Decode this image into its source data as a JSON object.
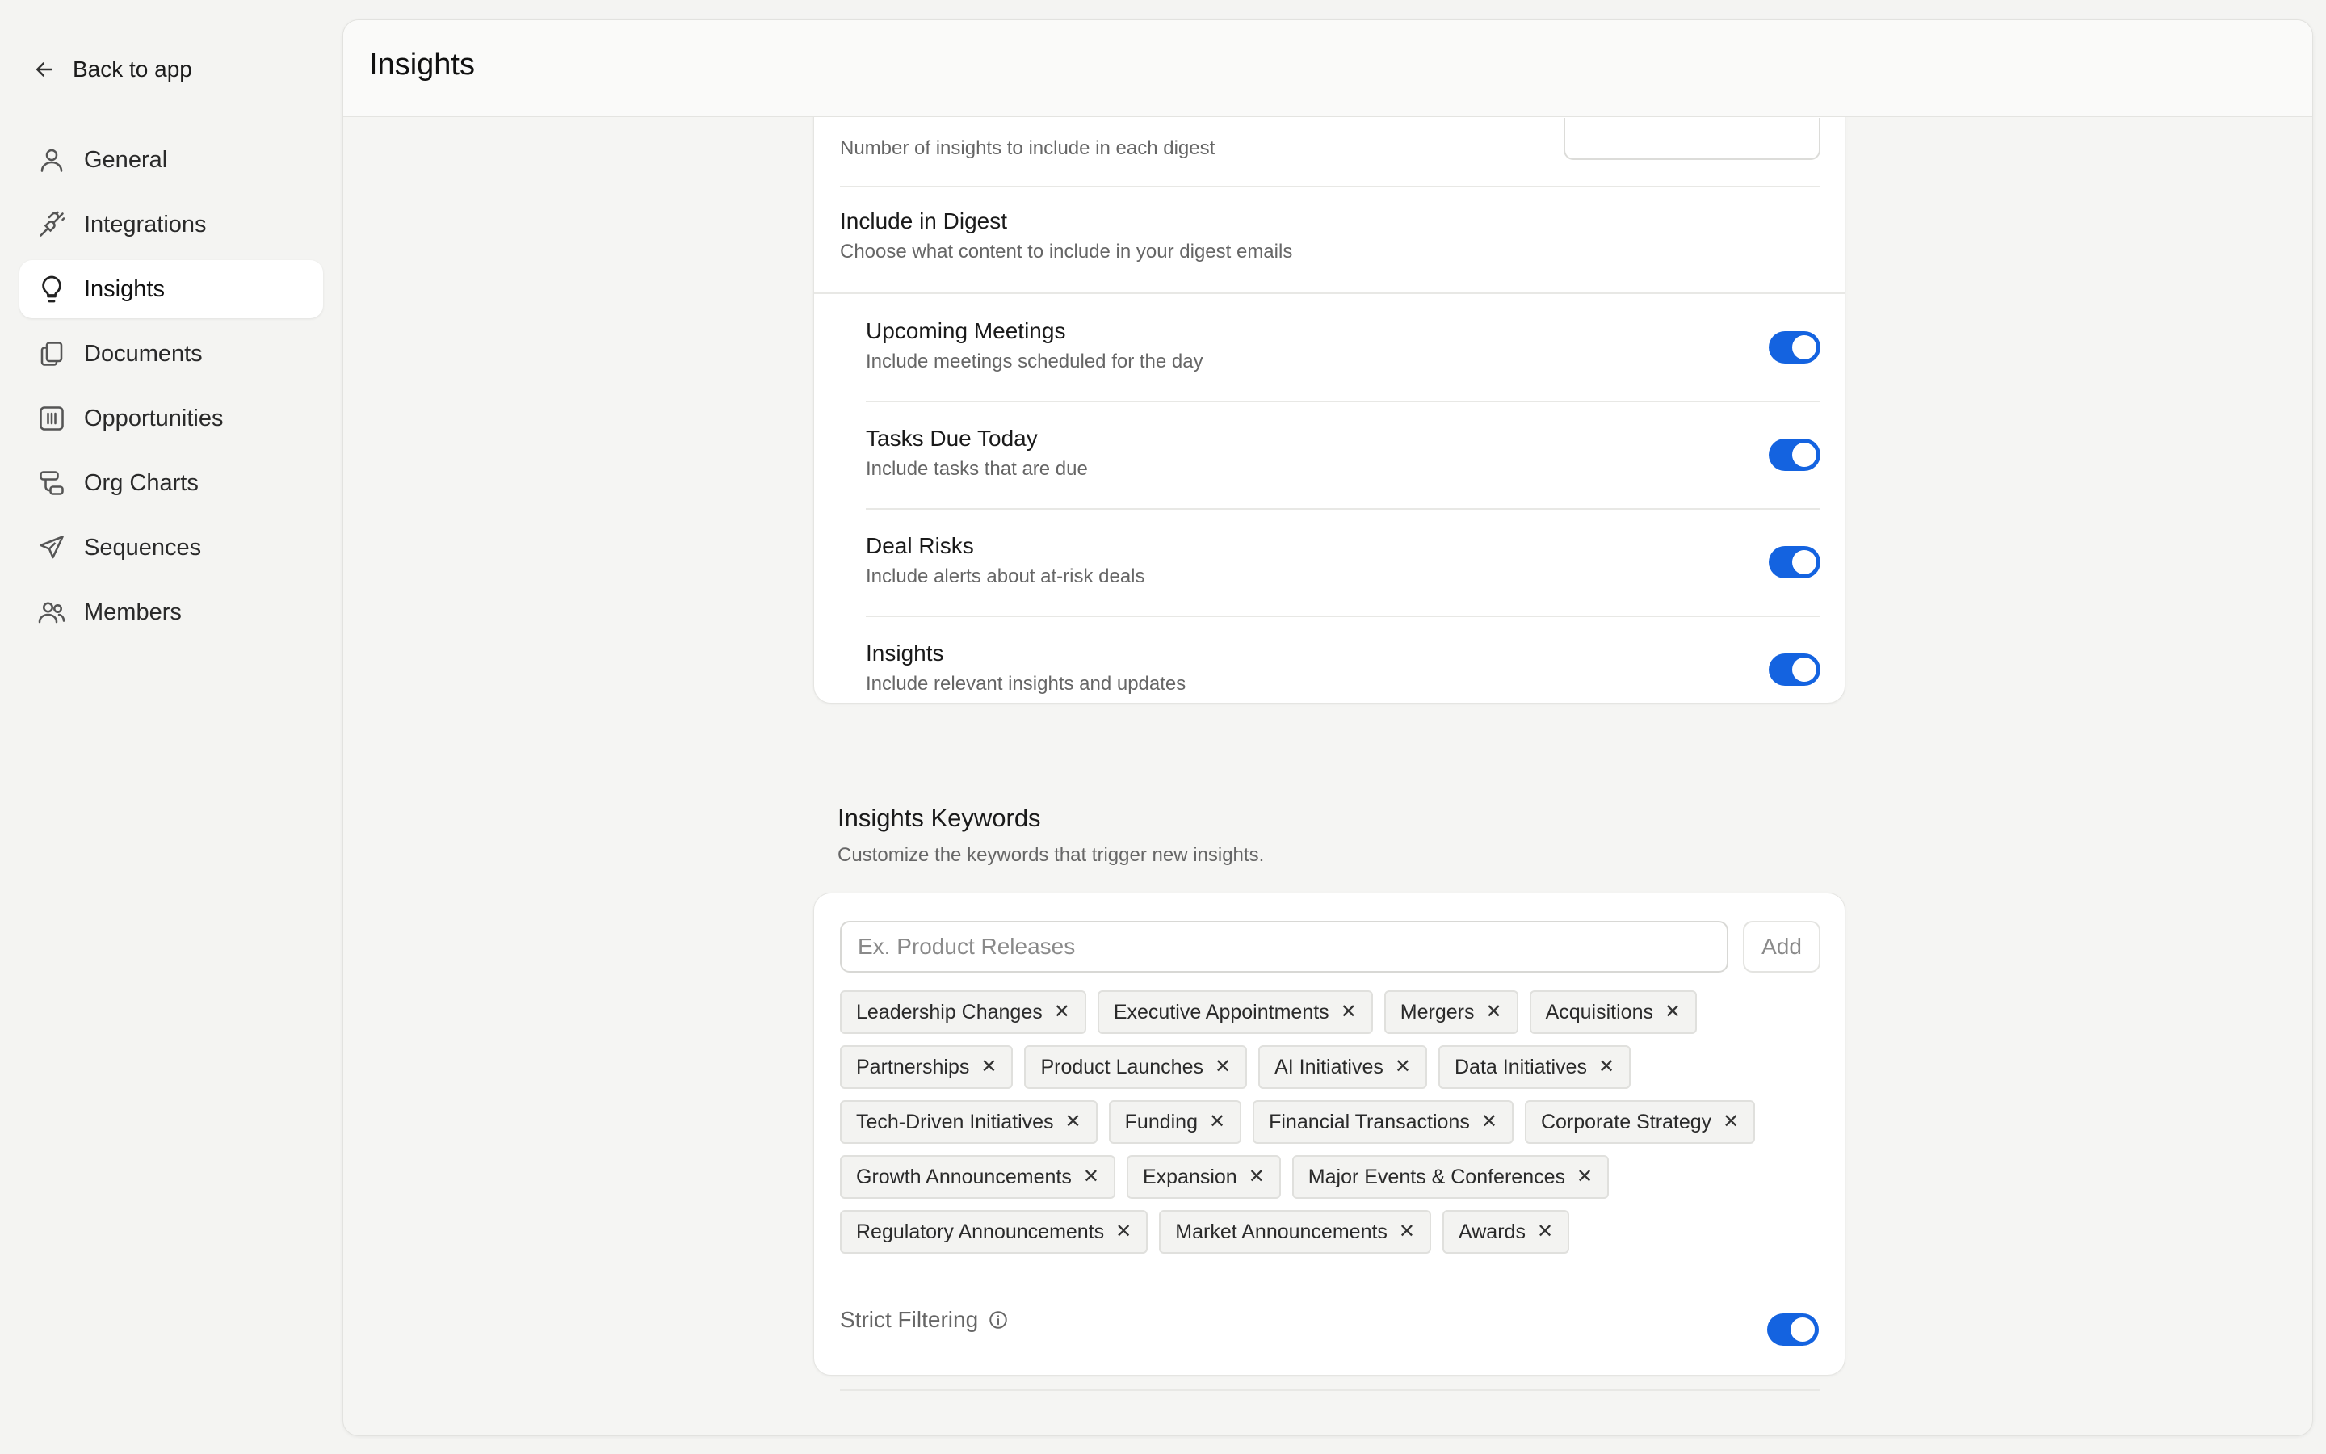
{
  "sidebar": {
    "back_label": "Back to app",
    "items": [
      {
        "label": "General",
        "icon": "user-icon",
        "active": false
      },
      {
        "label": "Integrations",
        "icon": "plug-icon",
        "active": false
      },
      {
        "label": "Insights",
        "icon": "lightbulb-icon",
        "active": true
      },
      {
        "label": "Documents",
        "icon": "documents-icon",
        "active": false
      },
      {
        "label": "Opportunities",
        "icon": "columns-icon",
        "active": false
      },
      {
        "label": "Org Charts",
        "icon": "org-chart-icon",
        "active": false
      },
      {
        "label": "Sequences",
        "icon": "send-icon",
        "active": false
      },
      {
        "label": "Members",
        "icon": "users-icon",
        "active": false
      }
    ]
  },
  "header": {
    "title": "Insights"
  },
  "digest": {
    "count_desc": "Number of insights to include in each digest",
    "include_title": "Include in Digest",
    "include_desc": "Choose what content to include in your digest emails",
    "options": [
      {
        "title": "Upcoming Meetings",
        "desc": "Include meetings scheduled for the day",
        "enabled": true
      },
      {
        "title": "Tasks Due Today",
        "desc": "Include tasks that are due",
        "enabled": true
      },
      {
        "title": "Deal Risks",
        "desc": "Include alerts about at-risk deals",
        "enabled": true
      },
      {
        "title": "Insights",
        "desc": "Include relevant insights and updates",
        "enabled": true
      }
    ]
  },
  "keywords": {
    "title": "Insights Keywords",
    "desc": "Customize the keywords that trigger new insights.",
    "input_placeholder": "Ex. Product Releases",
    "add_label": "Add",
    "tags": [
      "Leadership Changes",
      "Executive Appointments",
      "Mergers",
      "Acquisitions",
      "Partnerships",
      "Product Launches",
      "AI Initiatives",
      "Data Initiatives",
      "Tech-Driven Initiatives",
      "Funding",
      "Financial Transactions",
      "Corporate Strategy",
      "Growth Announcements",
      "Expansion",
      "Major Events & Conferences",
      "Regulatory Announcements",
      "Market Announcements",
      "Awards"
    ],
    "remove_glyph": "✕",
    "strict_label": "Strict Filtering",
    "strict_enabled": true
  },
  "colors": {
    "accent": "#1463e0",
    "background": "#f4f4f2",
    "card": "#ffffff"
  }
}
